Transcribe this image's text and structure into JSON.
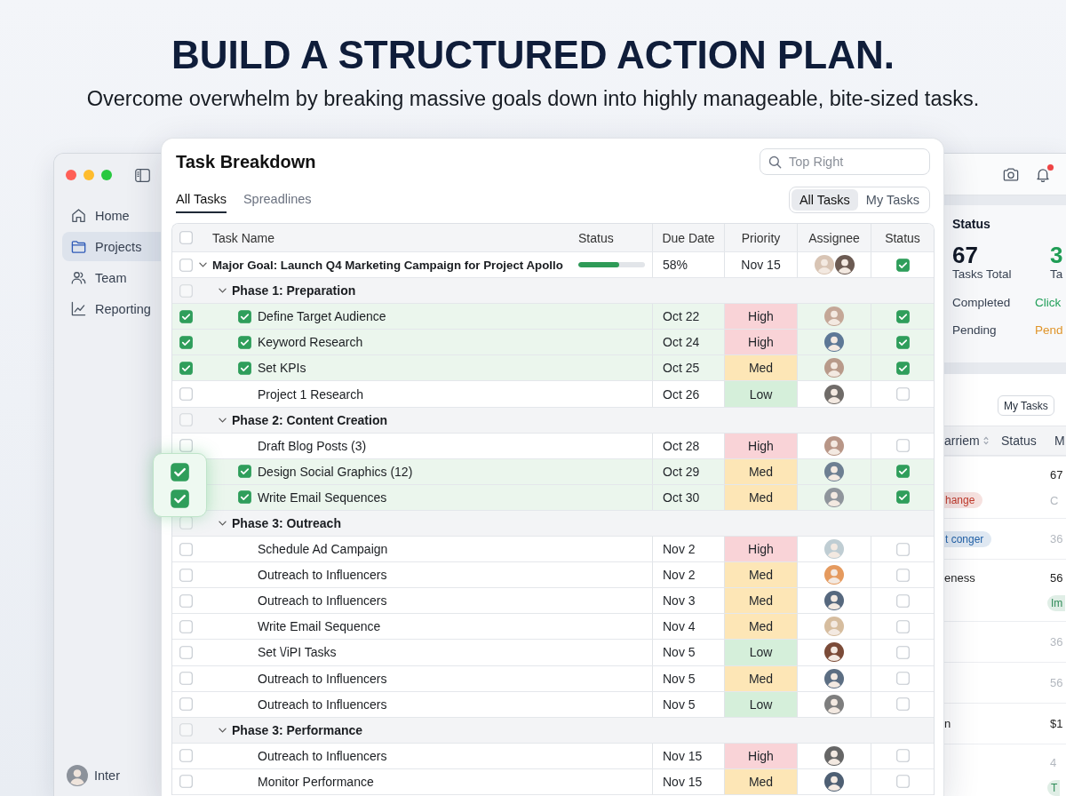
{
  "headline": {
    "title": "BUILD A STRUCTURED ACTION PLAN.",
    "subtitle": "Overcome overwhelm by breaking massive goals down into highly manageable, bite-sized tasks."
  },
  "back_window": {
    "sidebar": {
      "items": [
        {
          "label": "Home",
          "selected": false
        },
        {
          "label": "Projects",
          "selected": true
        },
        {
          "label": "Team",
          "selected": false
        },
        {
          "label": "Reporting",
          "selected": false
        }
      ],
      "user": {
        "name": "Inter"
      }
    },
    "toolbar": {
      "notification": true
    },
    "status_panel": {
      "title": "Status",
      "stats": [
        {
          "value": "67",
          "label": "Tasks Total",
          "color": "#111827"
        },
        {
          "value": "3",
          "label": "Ta",
          "color": "#1f9d55"
        }
      ],
      "rows": [
        {
          "label": "Completed",
          "value": "Click",
          "color": "#22a05a"
        },
        {
          "label": "Pending",
          "value": "Pend",
          "color": "#e0952a"
        }
      ]
    },
    "tasks_panel": {
      "filter": {
        "label": "My Tasks"
      },
      "columns": [
        {
          "label": "arriem",
          "sortable": true
        },
        {
          "label": "Status",
          "sortable": false
        },
        {
          "label": "M",
          "sortable": false
        }
      ],
      "rows": [
        {
          "lines": [
            {
              "right": {
                "kind": "text",
                "text": "67",
                "muted": false
              }
            },
            {
              "left": {
                "kind": "tag",
                "text": "hange",
                "color": "#c0392b"
              },
              "right": {
                "kind": "text",
                "text": "C",
                "muted": true
              }
            }
          ]
        },
        {
          "lines": [
            {
              "left": {
                "kind": "tag",
                "text": "t conger",
                "color": "#2563a8"
              },
              "right": {
                "kind": "text",
                "text": "36",
                "muted": true
              }
            }
          ]
        },
        {
          "lines": [
            {
              "left": {
                "kind": "text",
                "text": "eness",
                "muted": false
              },
              "right": {
                "kind": "text",
                "text": "56",
                "muted": false
              }
            },
            {
              "right": {
                "kind": "tag",
                "text": "Im",
                "color": "#2e8b57"
              }
            }
          ]
        },
        {
          "lines": [
            {
              "right": {
                "kind": "text",
                "text": "36",
                "muted": true
              }
            }
          ]
        },
        {
          "lines": [
            {
              "right": {
                "kind": "text",
                "text": "56",
                "muted": true
              }
            }
          ]
        },
        {
          "lines": [
            {
              "left": {
                "kind": "text",
                "text": "n",
                "muted": false
              },
              "right": {
                "kind": "text",
                "text": "$1",
                "muted": false
              }
            }
          ]
        },
        {
          "lines": [
            {
              "right": {
                "kind": "text",
                "text": "4",
                "muted": true
              }
            },
            {
              "right": {
                "kind": "tag",
                "text": "T",
                "color": "#2e8b57"
              }
            }
          ]
        }
      ]
    }
  },
  "task_window": {
    "title": "Task Breakdown",
    "search": {
      "placeholder": "Top Right"
    },
    "tabs": [
      {
        "label": "All Tasks",
        "selected": true
      },
      {
        "label": "Spreadlines",
        "selected": false
      }
    ],
    "view_toggle": [
      {
        "label": "All Tasks",
        "selected": true
      },
      {
        "label": "My Tasks",
        "selected": false
      }
    ],
    "table": {
      "selected": false,
      "columns": [
        "Task Name",
        "Status",
        "Due Date",
        "Priority",
        "Assignee",
        "Status"
      ],
      "goal": {
        "selected": false,
        "expanded": true,
        "title": "Major Goal: Launch Q4 Marketing Campaign for Project Apollo",
        "level": 0.61,
        "due_date": "58%",
        "priority": {
          "text": "Nov 15"
        },
        "assignees": [
          {
            "color": "#d8c4b4"
          },
          {
            "color": "#6b5a52"
          }
        ],
        "status_checked": true,
        "children": [
          {
            "selected": false,
            "expanded": true,
            "title": "Phase 1: Preparation",
            "children": [
              {
                "selected": true,
                "completed": true,
                "title": "Define Target Audience",
                "due_date": "Oct 22",
                "priority": {
                  "text": "High",
                  "color": "#f9d3d7"
                },
                "assignees": [
                  {
                    "color": "#c4a797"
                  }
                ],
                "status_checked": true
              },
              {
                "selected": true,
                "completed": true,
                "title": "Keyword Research",
                "due_date": "Oct 24",
                "priority": {
                  "text": "High",
                  "color": "#f9d3d7"
                },
                "assignees": [
                  {
                    "color": "#5d7896"
                  }
                ],
                "status_checked": true
              },
              {
                "selected": true,
                "completed": true,
                "title": "Set KPIs",
                "due_date": "Oct 25",
                "priority": {
                  "text": "Med",
                  "color": "#fde6b6"
                },
                "assignees": [
                  {
                    "color": "#b89a8a"
                  }
                ],
                "status_checked": true
              },
              {
                "selected": false,
                "completed": false,
                "title": "Project 1 Research",
                "due_date": "Oct 26",
                "priority": {
                  "text": "Low",
                  "color": "#d5efda"
                },
                "assignees": [
                  {
                    "color": "#6f6b68"
                  }
                ],
                "status_checked": false
              }
            ]
          },
          {
            "selected": false,
            "expanded": true,
            "title": "Phase 2: Content Creation",
            "children": [
              {
                "selected": false,
                "completed": false,
                "title": "Draft Blog Posts (3)",
                "due_date": "Oct 28",
                "priority": {
                  "text": "High",
                  "color": "#f9d3d7"
                },
                "assignees": [
                  {
                    "color": "#b89687"
                  }
                ],
                "status_checked": false
              },
              {
                "completed": true,
                "title": "Design Social Graphics (12)",
                "due_date": "Oct 29",
                "priority": {
                  "text": "Med",
                  "color": "#fde6b6"
                },
                "assignees": [
                  {
                    "color": "#6d7f92"
                  }
                ],
                "status_checked": true
              },
              {
                "completed": true,
                "title": "Write Email Sequences",
                "due_date": "Oct 30",
                "priority": {
                  "text": "Med",
                  "color": "#fde6b6"
                },
                "assignees": [
                  {
                    "color": "#8f959c"
                  }
                ],
                "status_checked": true
              }
            ]
          },
          {
            "selected": false,
            "expanded": true,
            "title": "Phase 3: Outreach",
            "children": [
              {
                "selected": false,
                "completed": false,
                "title": "Schedule Ad Campaign",
                "due_date": "Nov 2",
                "priority": {
                  "text": "High",
                  "color": "#f9d3d7"
                },
                "assignees": [
                  {
                    "color": "#bfcdd3"
                  }
                ],
                "status_checked": false
              },
              {
                "selected": false,
                "completed": false,
                "title": "Outreach to Influencers",
                "due_date": "Nov 2",
                "priority": {
                  "text": "Med",
                  "color": "#fde6b6"
                },
                "assignees": [
                  {
                    "color": "#e59a5e"
                  }
                ],
                "status_checked": false
              },
              {
                "selected": false,
                "completed": false,
                "title": "Outreach to Influencers",
                "due_date": "Nov 3",
                "priority": {
                  "text": "Med",
                  "color": "#fde6b6"
                },
                "assignees": [
                  {
                    "color": "#56687e"
                  }
                ],
                "status_checked": false
              },
              {
                "selected": false,
                "completed": false,
                "title": "Write Email Sequence",
                "due_date": "Nov 4",
                "priority": {
                  "text": "Med",
                  "color": "#fde6b6"
                },
                "assignees": [
                  {
                    "color": "#d6bd9f"
                  }
                ],
                "status_checked": false
              },
              {
                "selected": false,
                "completed": false,
                "title": "Set \\/iPI Tasks",
                "due_date": "Nov 5",
                "priority": {
                  "text": "Low",
                  "color": "#d5efda"
                },
                "assignees": [
                  {
                    "color": "#7b4b38"
                  }
                ],
                "status_checked": false
              },
              {
                "selected": false,
                "completed": false,
                "title": "Outreach to Influencers",
                "due_date": "Nov 5",
                "priority": {
                  "text": "Med",
                  "color": "#fde6b6"
                },
                "assignees": [
                  {
                    "color": "#5c6e83"
                  }
                ],
                "status_checked": false
              },
              {
                "selected": false,
                "completed": false,
                "title": "Outreach to Influencers",
                "due_date": "Nov 5",
                "priority": {
                  "text": "Low",
                  "color": "#d5efda"
                },
                "assignees": [
                  {
                    "color": "#7e7e7e"
                  }
                ],
                "status_checked": false
              }
            ]
          },
          {
            "selected": false,
            "expanded": true,
            "title": "Phase 3: Performance",
            "children": [
              {
                "selected": false,
                "completed": false,
                "title": "Outreach to Influencers",
                "due_date": "Nov 15",
                "priority": {
                  "text": "High",
                  "color": "#f9d3d7"
                },
                "assignees": [
                  {
                    "color": "#666666"
                  }
                ],
                "status_checked": false
              },
              {
                "selected": false,
                "completed": false,
                "title": "Monitor Performance",
                "due_date": "Nov 15",
                "priority": {
                  "text": "Med",
                  "color": "#fde6b6"
                },
                "assignees": [
                  {
                    "color": "#4e5f73"
                  }
                ],
                "status_checked": false
              }
            ]
          }
        ]
      }
    }
  },
  "floating_checks": [
    {
      "checked": true
    },
    {
      "checked": true
    }
  ]
}
